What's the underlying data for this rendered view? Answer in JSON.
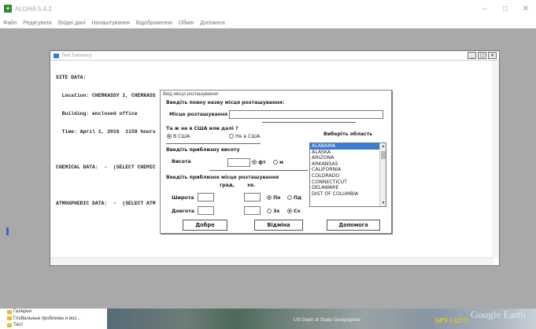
{
  "window": {
    "title": "ALOHA 5.4.2",
    "minimize": "–",
    "maximize": "□",
    "close": "✕"
  },
  "menu": [
    "Файл",
    "Редагувати",
    "Вхідні дані",
    "Налаштування",
    "Відображення",
    "Обмін",
    "Допомога"
  ],
  "text_summary": {
    "title": "Text Summary",
    "lines": [
      "SITE DATA:",
      "  Location: CHERKASSY 1, CHERKASS",
      "  Building: enclosed office",
      "  Time: April 1, 2016  1159 hours",
      "",
      "CHEMICAL DATA:  -  (SELECT CHEMIC",
      "",
      "ATMOSPHERIC DATA:  -  (SELECT ATM"
    ],
    "btn_min": "_",
    "btn_max": "▢",
    "btn_close": "✕"
  },
  "dialog": {
    "title": "Ввід місця розташування",
    "name_prompt": "Введіть повну назву місця розташування:",
    "name_label": "Місце розташування",
    "name_value": "",
    "us_question": "Та ж не в США или далі ?",
    "in_us": "В США",
    "not_in_us": "Не в США",
    "choose_region": "Виберіть область",
    "elevation_prompt": "Введіть приблизну висоту",
    "elevation_label": "Висота",
    "elevation_value": "",
    "unit_ft": "фт",
    "unit_m": "м",
    "coords_prompt": "Введіть приблизне місце розташування",
    "deg": "град.",
    "min": "хв.",
    "latitude": "Широта",
    "longitude": "Довгота",
    "north": "Пн",
    "south": "Пд",
    "west": "Зх",
    "east": "Сх",
    "states": [
      "ALABAMA",
      "ALASKA",
      "ARIZONA",
      "ARKANSAS",
      "CALIFORNIA",
      "COLORADO",
      "CONNECTICUT",
      "DELAWARE",
      "DIST OF COLUMBIA"
    ],
    "selected_state": "ALABAMA",
    "ok": "Добре",
    "cancel": "Відміна",
    "help": "Допомога"
  },
  "taskbar": {
    "tree": [
      "Галерея",
      "Глобальные проблемы и воз...",
      "Тест"
    ],
    "map_coords": "US Dept of State Geographer",
    "map_temp": "54°F / 12°C",
    "map_logo": "Google Earth"
  }
}
